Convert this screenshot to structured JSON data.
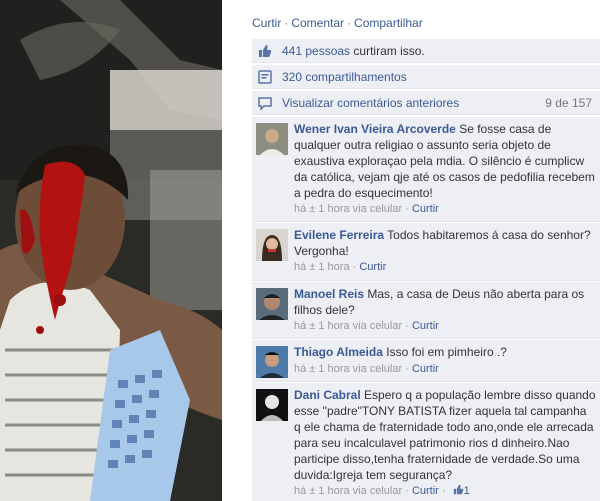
{
  "actions": {
    "like": "Curtir",
    "comment": "Comentar",
    "share": "Compartilhar",
    "separator": "·"
  },
  "summary": {
    "likes_count": "441 pessoas",
    "likes_suffix": " curtiram isso.",
    "shares": "320 compartilhamentos",
    "view_previous": "Visualizar comentários anteriores",
    "page_count": "9 de 157"
  },
  "comments": [
    {
      "author": "Wener Ivan Vieira Arcoverde",
      "text": " Se fosse casa de qualquer outra religiao o assunto seria objeto de exaustiva exploraçao pela mdia. O silêncio é cumplicw da católica, vejam qje até os casos de pedofilia recebem a pedra do esquecimento!",
      "time": "há ± 1 hora via celular",
      "like": "Curtir"
    },
    {
      "author": "Evilene Ferreira",
      "text": " Todos habitaremos á casa do senhor?Vergonha!",
      "time": "há ± 1 hora",
      "like": "Curtir"
    },
    {
      "author": "Manoel Reis",
      "text": " Mas, a casa de Deus não aberta para os filhos dele?",
      "time": "há ± 1 hora via celular",
      "like": "Curtir"
    },
    {
      "author": "Thiago Almeida",
      "text": " Isso foi em pimheiro .?",
      "time": "há ± 1 hora via celular",
      "like": "Curtir"
    },
    {
      "author": "Dani Cabral",
      "text": " Espero q a população lembre disso quando esse \"padre\"TONY BATISTA fizer aquela tal campanha q ele chama de fraternidade todo ano,onde ele arrecada para seu incalculavel patrimonio rios d dinheiro.Nao participe disso,tenha fraternidade de verdade.So uma duvida:Igreja tem segurança?",
      "time": "há ± 1 hora via celular",
      "like": "Curtir",
      "like_count": "1"
    }
  ],
  "colors": {
    "link": "#3b5998",
    "row_bg": "#edeff4",
    "meta": "#999999"
  },
  "icons": {
    "likes": "thumbs-up-icon",
    "shares": "share-icon",
    "comments": "comment-bubble-icon"
  }
}
